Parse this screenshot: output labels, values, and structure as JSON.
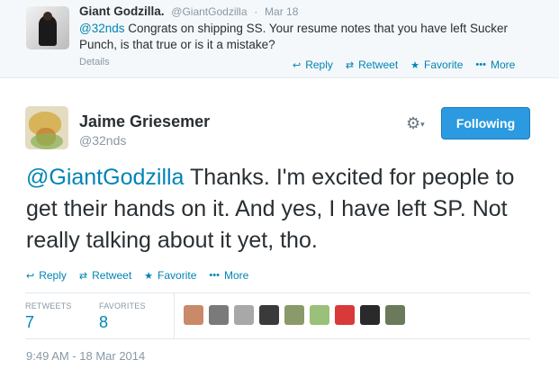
{
  "parent_tweet": {
    "name": "Giant Godzilla.",
    "handle": "@GiantGodzilla",
    "date": "Mar 18",
    "mention": "@32nds",
    "text": " Congrats on shipping SS. Your resume notes that you have left Sucker Punch, is that true or is it a mistake?",
    "details": "Details",
    "actions": {
      "reply": "Reply",
      "retweet": "Retweet",
      "favorite": "Favorite",
      "more": "More"
    }
  },
  "main_tweet": {
    "name": "Jaime Griesemer",
    "handle": "@32nds",
    "follow_label": "Following",
    "mention": "@GiantGodzilla",
    "text": " Thanks. I'm excited for people to get their hands on it. And yes, I have left SP. Not really talking about it yet, tho.",
    "actions": {
      "reply": "Reply",
      "retweet": "Retweet",
      "favorite": "Favorite",
      "more": "More"
    },
    "stats": {
      "retweets_label": "RETWEETS",
      "retweets": "7",
      "favorites_label": "FAVORITES",
      "favorites": "8"
    },
    "favoriter_colors": [
      "#c98a6a",
      "#7a7a7a",
      "#a8a8a8",
      "#3a3a3a",
      "#8a9a6a",
      "#9ac07a",
      "#d83a3a",
      "#2a2a2a",
      "#6a7a5a"
    ],
    "timestamp": "9:49 AM - 18 Mar 2014"
  },
  "icons": {
    "reply": "reply-icon",
    "retweet": "retweet-icon",
    "favorite": "star-icon",
    "more": "more-icon",
    "gear": "gear-icon"
  },
  "colors": {
    "link": "#0084b4",
    "follow_button": "#2b9ae0",
    "muted": "#8899a6"
  }
}
